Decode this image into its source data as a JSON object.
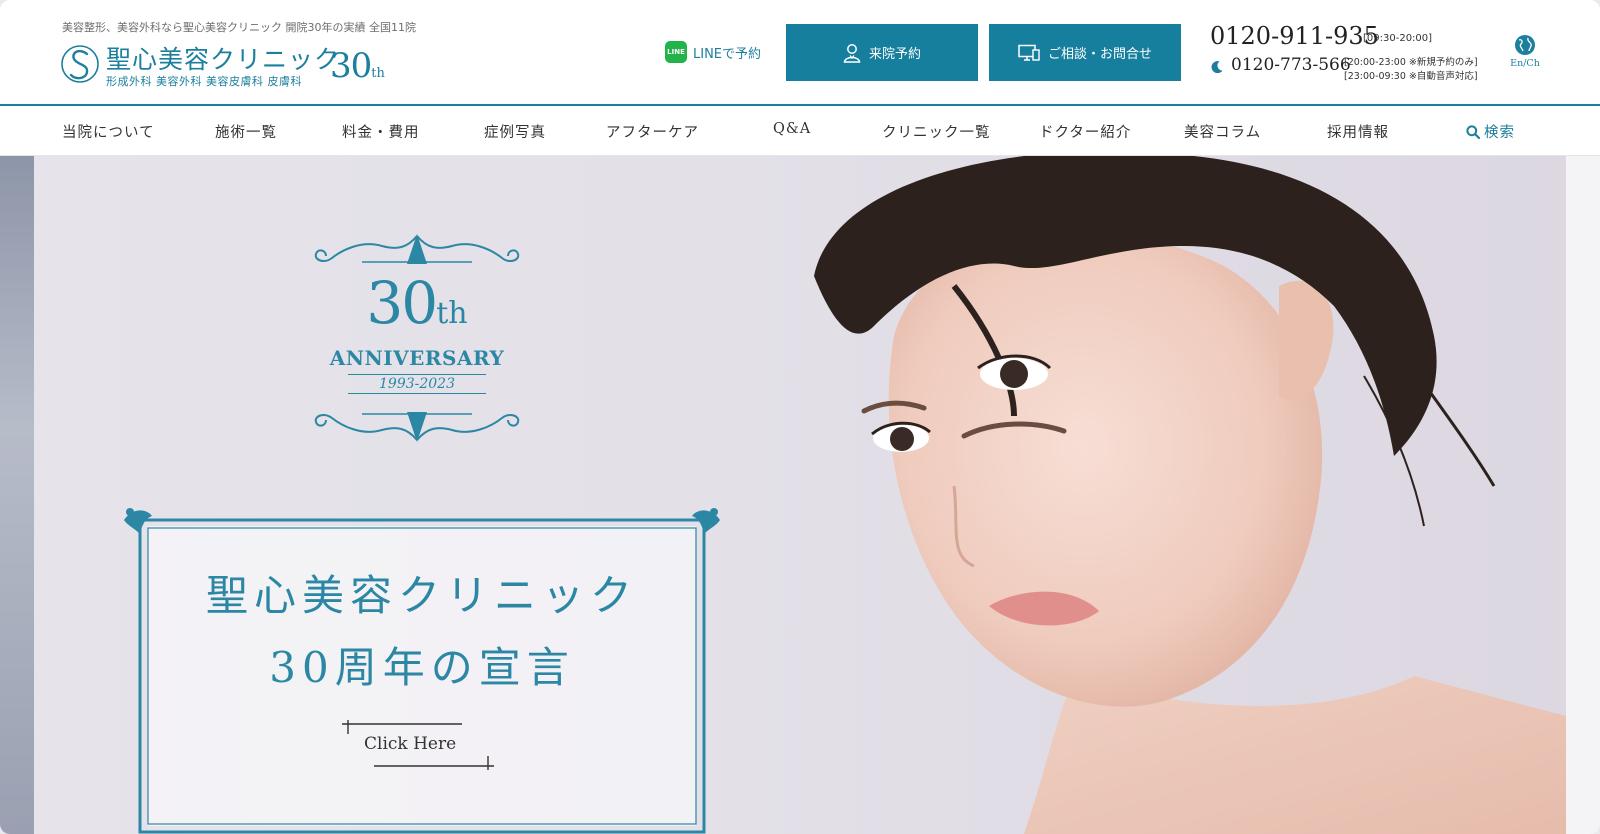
{
  "colors": {
    "accent": "#1b7f9d",
    "cta": "#177f9e",
    "line_green": "#22b34a"
  },
  "header": {
    "tagline": "美容整形、美容外科なら聖心美容クリニック 開院30年の実績 全国11院",
    "logo": {
      "name": "聖心美容クリニック",
      "sub": "形成外科 美容外科 美容皮膚科 皮膚科",
      "anniv_num": "30",
      "anniv_suffix": "th"
    },
    "line_link": {
      "icon": "line-icon",
      "icon_text": "LINE",
      "label": "LINEで予約"
    },
    "cta_reserve": {
      "icon": "person-icon",
      "label": "来院予約"
    },
    "cta_contact": {
      "icon": "monitor-icon",
      "label": "ご相談・お問合せ"
    },
    "tel_main": {
      "number": "0120-911-935",
      "hours": "[09:30-20:00]"
    },
    "tel_sub": {
      "icon": "moon-icon",
      "number": "0120-773-566",
      "hours1": "[20:00-23:00 ※新規予約のみ]",
      "hours2": "[23:00-09:30 ※自動音声対応]"
    },
    "lang": {
      "icon": "globe-icon",
      "label": "En/Ch"
    }
  },
  "nav": {
    "items": [
      "当院について",
      "施術一覧",
      "料金・費用",
      "症例写真",
      "アフターケア",
      "Q&A",
      "クリニック一覧",
      "ドクター紹介",
      "美容コラム",
      "採用情報"
    ],
    "search": {
      "icon": "search-icon",
      "label": "検索"
    }
  },
  "hero": {
    "emblem": {
      "num": "30",
      "suffix": "th",
      "anniversary": "ANNIVERSARY",
      "years": "1993-2023"
    },
    "title_line1": "聖心美容クリニック",
    "title_line2": "30周年の宣言",
    "click_here": "Click Here"
  }
}
